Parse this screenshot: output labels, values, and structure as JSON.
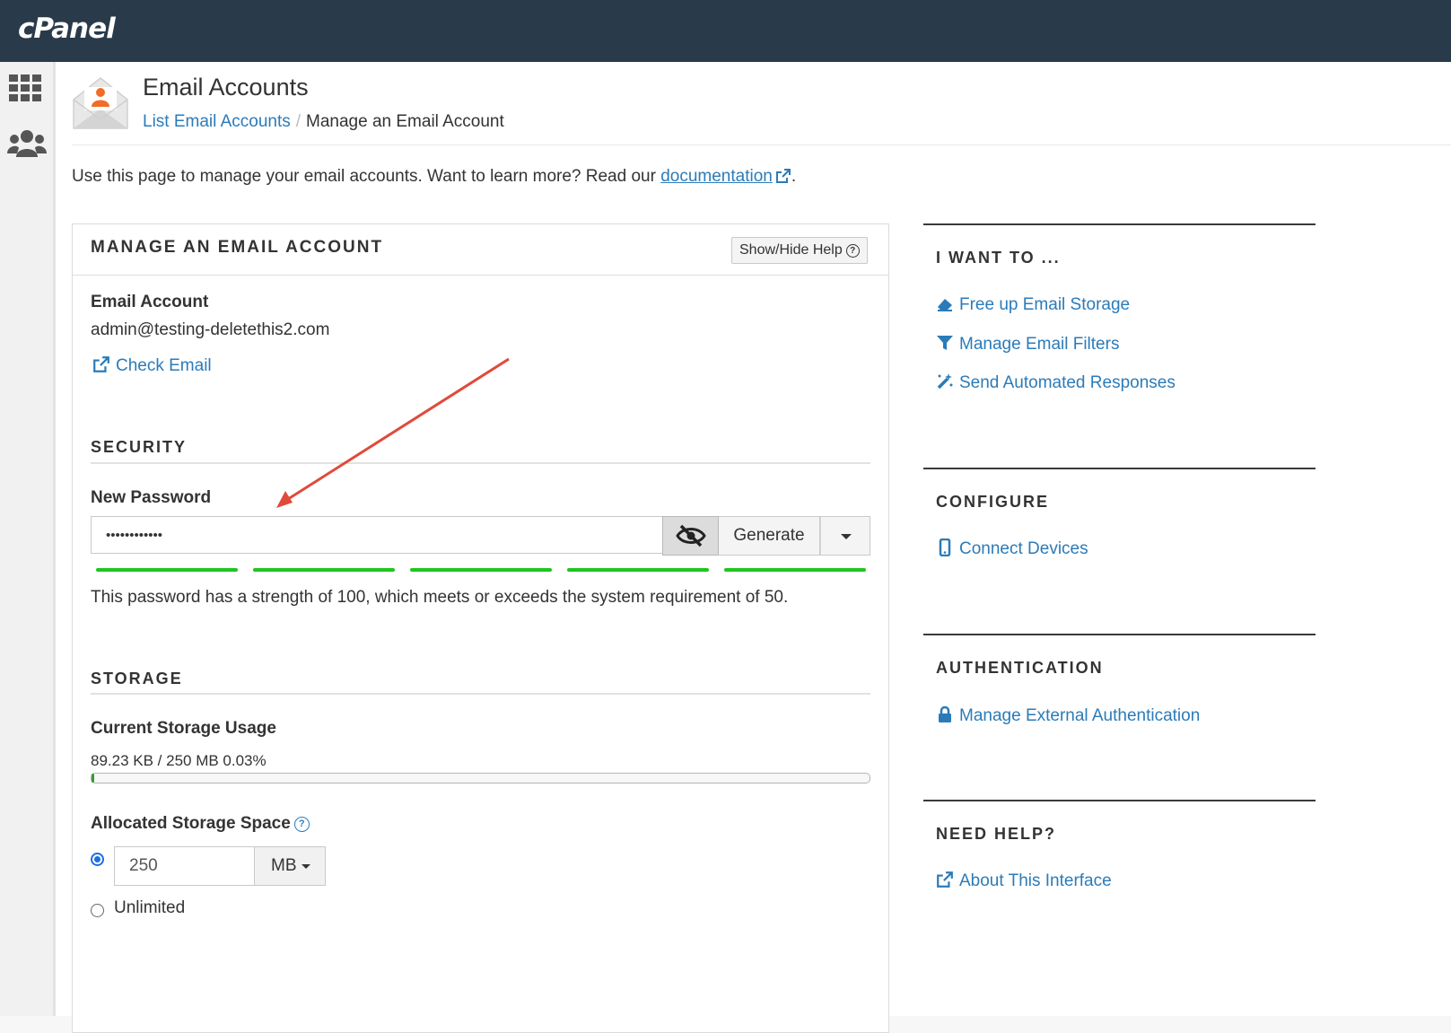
{
  "brand": {
    "logo_text": "cPanel"
  },
  "header": {
    "title": "Email Accounts",
    "breadcrumb": {
      "parent": "List Email Accounts",
      "separator": "/",
      "current": "Manage an Email Account"
    }
  },
  "intro": {
    "text": "Use this page to manage your email accounts. Want to learn more? Read our ",
    "link": "documentation",
    "suffix": "."
  },
  "panel": {
    "title": "MANAGE AN EMAIL ACCOUNT",
    "help_button": "Show/Hide Help",
    "account_label": "Email Account",
    "account_value": "admin@testing-deletethis2.com",
    "check_email": "Check Email",
    "security": {
      "title": "SECURITY",
      "password_label": "New Password",
      "password_value": "••••••••••••",
      "generate_label": "Generate",
      "strength_segments": 5,
      "strength_text": "This password has a strength of 100, which meets or exceeds the system requirement of 50."
    },
    "storage": {
      "title": "STORAGE",
      "usage_label": "Current Storage Usage",
      "usage_value": "89.23 KB / 250 MB 0.03%",
      "usage_fraction": 0.0003,
      "allocated_label": "Allocated Storage Space",
      "allocated_value": "250",
      "unit": "MB",
      "unlimited_label": "Unlimited"
    }
  },
  "sidebar": {
    "sections": [
      {
        "title": "I WANT TO ...",
        "links": [
          "Free up Email Storage",
          "Manage Email Filters",
          "Send Automated Responses"
        ]
      },
      {
        "title": "CONFIGURE",
        "links": [
          "Connect Devices"
        ]
      },
      {
        "title": "AUTHENTICATION",
        "links": [
          "Manage External Authentication"
        ]
      },
      {
        "title": "NEED HELP?",
        "links": [
          "About This Interface"
        ]
      }
    ]
  },
  "colors": {
    "topbar": "#293a4a",
    "link": "#2b7bb9",
    "strength": "#1ec51e",
    "arrow": "#e04a3a"
  }
}
